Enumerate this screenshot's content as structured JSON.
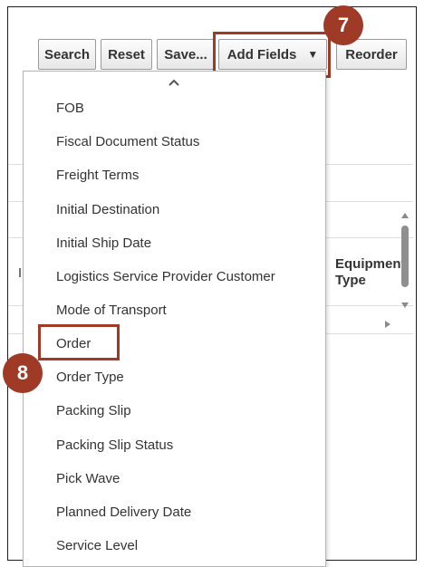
{
  "toolbar": {
    "search_label": "Search",
    "reset_label": "Reset",
    "save_label": "Save...",
    "add_fields_label": "Add Fields",
    "reorder_label": "Reorder"
  },
  "callouts": {
    "step7": "7",
    "step8": "8"
  },
  "table": {
    "column_header_line1": "Equipment",
    "column_header_line2": "Type"
  },
  "menu": {
    "items": [
      "FOB",
      "Fiscal Document Status",
      "Freight Terms",
      "Initial Destination",
      "Initial Ship Date",
      "Logistics Service Provider Customer",
      "Mode of Transport",
      "Order",
      "Order Type",
      "Packing Slip",
      "Packing Slip Status",
      "Pick Wave",
      "Planned Delivery Date",
      "Service Level"
    ]
  },
  "colors": {
    "callout": "#9e3a26",
    "text": "#333333"
  }
}
